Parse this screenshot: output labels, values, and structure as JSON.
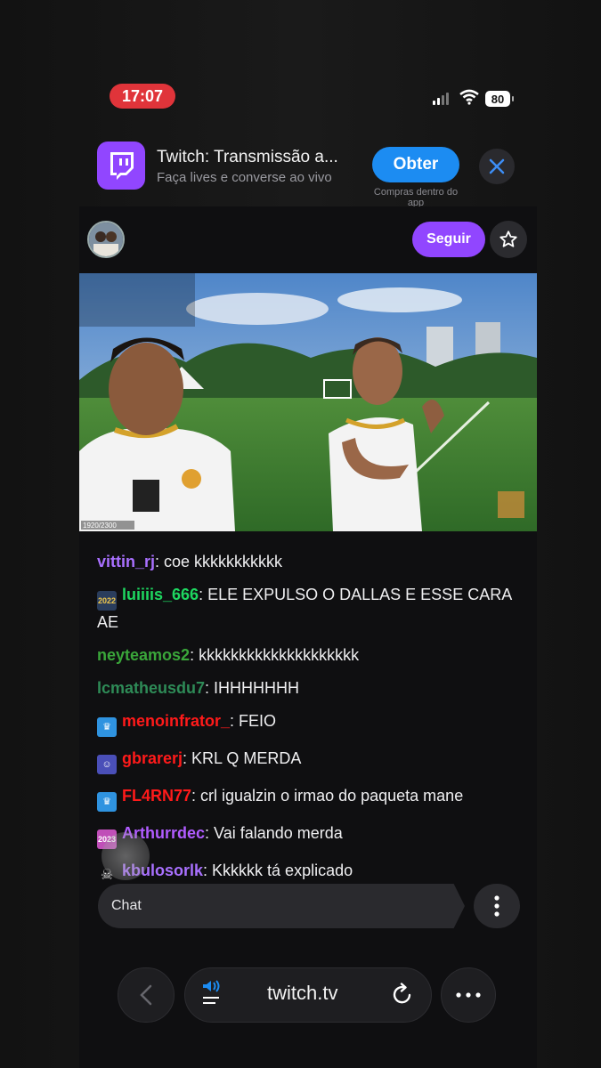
{
  "status_bar": {
    "time": "17:07",
    "battery": "80"
  },
  "app_banner": {
    "title": "Twitch: Transmissão a...",
    "subtitle": "Faça lives e converse  ao vivo",
    "get_label": "Obter",
    "note": "Compras dentro do app",
    "accent": "#9146ff",
    "button_color": "#1c8cf2"
  },
  "channel": {
    "follow_label": "Seguir"
  },
  "chat": {
    "messages": [
      {
        "badge": "",
        "user": "vittin_rj",
        "color": "#a970ff",
        "text": ": coe kkkkkkkkkkk"
      },
      {
        "badge": "2022",
        "user": "luiiiis_666",
        "color": "#1ed760",
        "text": ": ELE EXPULSO O DALLAS E ESSE CARA AE"
      },
      {
        "badge": "",
        "user": "neyteamos2",
        "color": "#3aa63a",
        "text": ": kkkkkkkkkkkkkkkkkkkk"
      },
      {
        "badge": "",
        "user": "lcmatheusdu7",
        "color": "#2e8b57",
        "text": ": IHHHHHHH"
      },
      {
        "badge": "crown",
        "user": "menoinfrator_",
        "color": "#ff1a1a",
        "text": ": FEIO"
      },
      {
        "badge": "group",
        "user": "gbrarerj",
        "color": "#ff1a1a",
        "text": ": KRL Q MERDA"
      },
      {
        "badge": "crown",
        "user": "FL4RN77",
        "color": "#ff1a1a",
        "text": ": crl igualzin o irmao do paqueta mane"
      },
      {
        "badge": "2023",
        "user": "Arthurrdec",
        "color": "#b05cff",
        "text": ": Vai falando merda"
      },
      {
        "badge": "skull",
        "user": "kbulosorlk",
        "color": "#a970ff",
        "text": ": Kkkkkk tá explicado"
      }
    ],
    "input_placeholder": "Chat"
  },
  "browser": {
    "url": "twitch.tv"
  }
}
